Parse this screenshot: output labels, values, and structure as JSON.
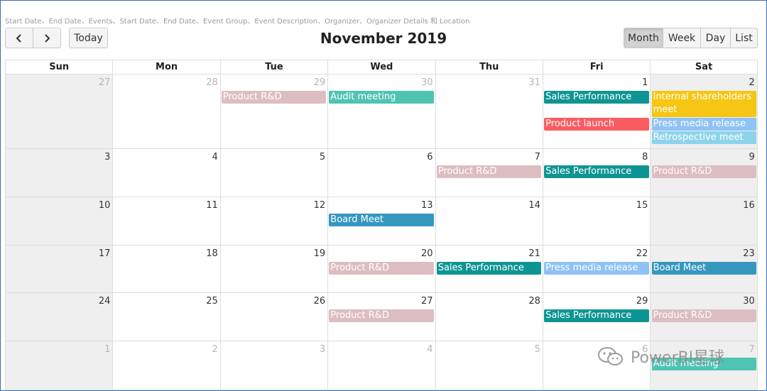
{
  "field_list": "Start Date、End Date、Events、Start Date、End Date、Event Group、Event Description、Organizer、Organizer Details 和 Location",
  "nav": {
    "prev_icon": "chevron-left-icon",
    "next_icon": "chevron-right-icon",
    "today_label": "Today"
  },
  "title": "November 2019",
  "views": {
    "month": "Month",
    "week": "Week",
    "day": "Day",
    "list": "List",
    "active": "Month"
  },
  "weekdays": [
    "Sun",
    "Mon",
    "Tue",
    "Wed",
    "Thu",
    "Fri",
    "Sat"
  ],
  "weeks": [
    [
      "27",
      "28",
      "29",
      "30",
      "31",
      "1",
      "2"
    ],
    [
      "3",
      "4",
      "5",
      "6",
      "7",
      "8",
      "9"
    ],
    [
      "10",
      "11",
      "12",
      "13",
      "14",
      "15",
      "16"
    ],
    [
      "17",
      "18",
      "19",
      "20",
      "21",
      "22",
      "23"
    ],
    [
      "24",
      "25",
      "26",
      "27",
      "28",
      "29",
      "30"
    ],
    [
      "1",
      "2",
      "3",
      "4",
      "5",
      "6",
      "7"
    ]
  ],
  "other_month": [
    [
      true,
      true,
      true,
      true,
      true,
      false,
      false
    ],
    [
      false,
      false,
      false,
      false,
      false,
      false,
      false
    ],
    [
      false,
      false,
      false,
      false,
      false,
      false,
      false
    ],
    [
      false,
      false,
      false,
      false,
      false,
      false,
      false
    ],
    [
      false,
      false,
      false,
      false,
      false,
      false,
      false
    ],
    [
      true,
      true,
      true,
      true,
      true,
      true,
      true
    ]
  ],
  "events": [
    {
      "title": "Product R&D",
      "week": 0,
      "day": 2,
      "slot": 0,
      "color": "#ddbec0"
    },
    {
      "title": "Audit meeting",
      "week": 0,
      "day": 3,
      "slot": 0,
      "color": "#4fc4b3"
    },
    {
      "title": "Sales Performance",
      "week": 0,
      "day": 5,
      "slot": 0,
      "color": "#0e9593"
    },
    {
      "title": "Product launch",
      "week": 0,
      "day": 5,
      "slot": 2,
      "color": "#fa5c61"
    },
    {
      "title": "Internal shareholders meet",
      "week": 0,
      "day": 6,
      "slot": 0,
      "color": "#f6c614",
      "tall": true
    },
    {
      "title": "Press media release",
      "week": 0,
      "day": 6,
      "slot": 2,
      "color": "#8fc2f5"
    },
    {
      "title": "Retrospective meet",
      "week": 0,
      "day": 6,
      "slot": 3,
      "color": "#8dd4ea"
    },
    {
      "title": "Product R&D",
      "week": 1,
      "day": 4,
      "slot": 0,
      "color": "#ddbec0"
    },
    {
      "title": "Sales Performance",
      "week": 1,
      "day": 5,
      "slot": 0,
      "color": "#0e9593"
    },
    {
      "title": "Product R&D",
      "week": 1,
      "day": 6,
      "slot": 0,
      "color": "#ddbec0"
    },
    {
      "title": "Board Meet",
      "week": 2,
      "day": 3,
      "slot": 0,
      "color": "#3597be"
    },
    {
      "title": "Product R&D",
      "week": 3,
      "day": 3,
      "slot": 0,
      "color": "#ddbec0"
    },
    {
      "title": "Sales Performance",
      "week": 3,
      "day": 4,
      "slot": 0,
      "color": "#0e9593"
    },
    {
      "title": "Press media release",
      "week": 3,
      "day": 5,
      "slot": 0,
      "color": "#8fc2f5"
    },
    {
      "title": "Board Meet",
      "week": 3,
      "day": 6,
      "slot": 0,
      "color": "#3597be"
    },
    {
      "title": "Product R&D",
      "week": 4,
      "day": 3,
      "slot": 0,
      "color": "#ddbec0"
    },
    {
      "title": "Sales Performance",
      "week": 4,
      "day": 5,
      "slot": 0,
      "color": "#0e9593"
    },
    {
      "title": "Product R&D",
      "week": 4,
      "day": 6,
      "slot": 0,
      "color": "#ddbec0"
    },
    {
      "title": "Audit meeting",
      "week": 5,
      "day": 6,
      "slot": 0,
      "color": "#4fc4b3"
    }
  ],
  "watermark": {
    "text": "PowerBI星球",
    "icon": "wechat-icon"
  }
}
